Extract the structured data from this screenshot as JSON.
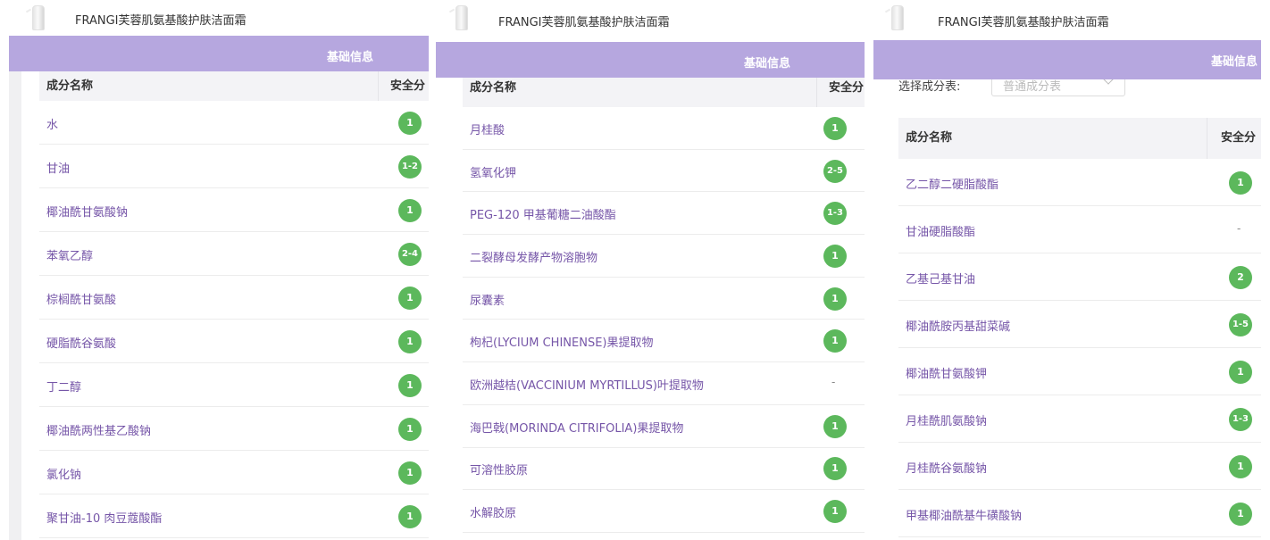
{
  "title": "FRANGI芙蓉肌氨基酸护肤洁面霜",
  "section_label": "基础信息",
  "col_name": "成分名称",
  "col_score": "安全分",
  "selector_label": "选择成分表:",
  "selector_value": "普通成分表",
  "panel1_rows": [
    {
      "name": "水",
      "score": "1"
    },
    {
      "name": "甘油",
      "score": "1-2"
    },
    {
      "name": "椰油酰甘氨酸钠",
      "score": "1"
    },
    {
      "name": "苯氧乙醇",
      "score": "2-4"
    },
    {
      "name": "棕榈酰甘氨酸",
      "score": "1"
    },
    {
      "name": "硬脂酰谷氨酸",
      "score": "1"
    },
    {
      "name": "丁二醇",
      "score": "1"
    },
    {
      "name": "椰油酰两性基乙酸钠",
      "score": "1"
    },
    {
      "name": "氯化钠",
      "score": "1"
    },
    {
      "name": "聚甘油-10 肉豆蔻酸酯",
      "score": "1"
    }
  ],
  "panel2_rows": [
    {
      "name": "月桂酸",
      "score": "1"
    },
    {
      "name": "氢氧化钾",
      "score": "2-5"
    },
    {
      "name": "PEG-120 甲基葡糖二油酸酯",
      "score": "1-3"
    },
    {
      "name": "二裂酵母发酵产物溶胞物",
      "score": "1"
    },
    {
      "name": "尿囊素",
      "score": "1"
    },
    {
      "name": "枸杞(LYCIUM CHINENSE)果提取物",
      "score": "1"
    },
    {
      "name": "欧洲越桔(VACCINIUM MYRTILLUS)叶提取物",
      "score": "-"
    },
    {
      "name": "海巴戟(MORINDA CITRIFOLIA)果提取物",
      "score": "1"
    },
    {
      "name": "可溶性胶原",
      "score": "1"
    },
    {
      "name": "水解胶原",
      "score": "1"
    }
  ],
  "panel3_rows": [
    {
      "name": "乙二醇二硬脂酸酯",
      "score": "1"
    },
    {
      "name": "甘油硬脂酸酯",
      "score": "-"
    },
    {
      "name": "乙基己基甘油",
      "score": "2"
    },
    {
      "name": "椰油酰胺丙基甜菜碱",
      "score": "1-5"
    },
    {
      "name": "椰油酰甘氨酸钾",
      "score": "1"
    },
    {
      "name": "月桂酰肌氨酸钠",
      "score": "1-3"
    },
    {
      "name": "月桂酰谷氨酸钠",
      "score": "1"
    },
    {
      "name": "甲基椰油酰基牛磺酸钠",
      "score": "1"
    }
  ],
  "colors": {
    "accent": "#b6a7df",
    "badge": "#5cb85c",
    "ingredient_text": "#7656a8"
  }
}
